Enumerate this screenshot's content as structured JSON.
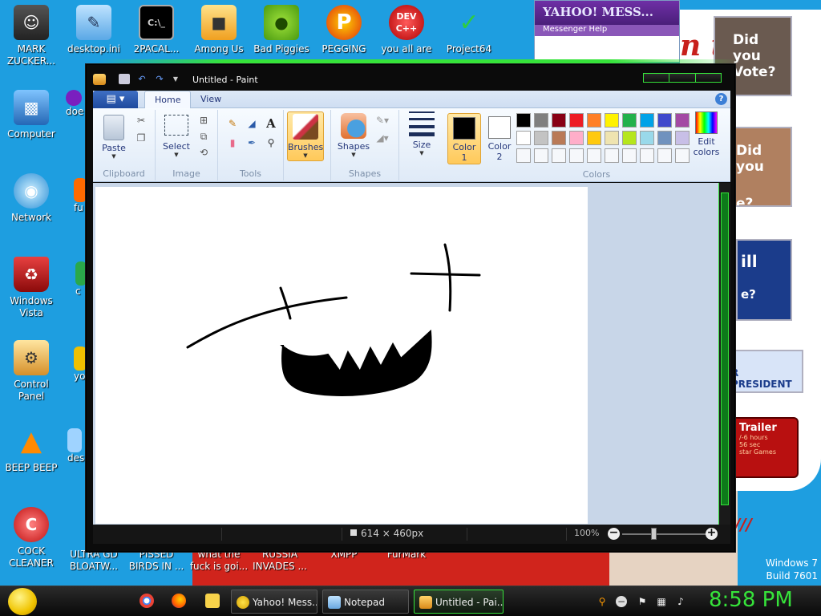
{
  "desktop": {
    "icons_left": [
      {
        "label": "MARK ZUCKER...",
        "icon": "user-folder-icon"
      },
      {
        "label": "Computer",
        "icon": "computer-icon"
      },
      {
        "label": "Network",
        "icon": "network-globe-icon"
      },
      {
        "label": "Windows Vista",
        "icon": "recycle-bin-icon"
      },
      {
        "label": "Control Panel",
        "icon": "control-panel-icon"
      },
      {
        "label": "BEEP BEEP",
        "icon": "vlc-cone-icon"
      },
      {
        "label": "COCK CLEANER",
        "icon": "ccleaner-icon"
      }
    ],
    "icons_top": [
      {
        "label": "desktop.ini",
        "icon": "ini-file-icon"
      },
      {
        "label": "2PACAL...",
        "icon": "cmd-icon"
      },
      {
        "label": "Among Us",
        "icon": "among-us-icon"
      },
      {
        "label": "Bad Piggies",
        "icon": "bad-piggies-icon"
      },
      {
        "label": "PEGGING",
        "icon": "pegging-icon"
      },
      {
        "label": "you all are",
        "icon": "devcpp-icon"
      },
      {
        "label": "Project64",
        "icon": "project64-icon"
      }
    ],
    "partial_col2": [
      "doe",
      "fu",
      "c",
      "yo",
      "des"
    ],
    "icons_bottom": [
      {
        "label": "ULTRA GD BLOATW..."
      },
      {
        "label": "PISSED BIRDS IN ..."
      },
      {
        "label": "what the fuck is goi..."
      },
      {
        "label": "RUSSIA INVADES ..."
      },
      {
        "label": "XMPP"
      },
      {
        "label": "FurMark"
      }
    ],
    "yahoo_title": "YAHOO! MESS...",
    "yahoo_menu": "Messenger     Help",
    "ads": {
      "obama": "Did you",
      "obama_sub": "Vote?",
      "face2": "Did you",
      "face2_sub": "e?",
      "will": "ill",
      "will_sub": "e?",
      "president": "R PRESIDENT",
      "trailer": "Trailer",
      "trailer_small": "/-6 hours\n56 sec\nstar Games"
    },
    "red_text": "n t",
    "windows_version": "Windows 7",
    "build": "Build 7601"
  },
  "paint": {
    "title": "Untitled - Paint",
    "tabs": [
      "Home",
      "View"
    ],
    "groups": {
      "clipboard": "Clipboard",
      "image": "Image",
      "tools": "Tools",
      "shapes": "Shapes",
      "colors": "Colors"
    },
    "buttons": {
      "paste": "Paste",
      "select": "Select",
      "brushes": "Brushes",
      "shapes": "Shapes",
      "size": "Size",
      "color1": "Color 1",
      "color2": "Color 2",
      "edit_colors": "Edit colors"
    },
    "palette_row1": [
      "#000000",
      "#7f7f7f",
      "#880015",
      "#ed1c24",
      "#ff7f27",
      "#fff200",
      "#22b14c",
      "#00a2e8",
      "#3f48cc",
      "#a349a4"
    ],
    "palette_row2": [
      "#ffffff",
      "#c3c3c3",
      "#b97a57",
      "#ffaec9",
      "#ffc90e",
      "#efe4b0",
      "#b5e61d",
      "#99d9ea",
      "#7092be",
      "#c8bfe7"
    ],
    "color1_value": "#000000",
    "color2_value": "#ffffff",
    "status": {
      "dimensions": "614 × 460px",
      "zoom": "100%"
    }
  },
  "taskbar": {
    "tasks": [
      "Yahoo! Mess...",
      "Notepad",
      "Untitled - Pai..."
    ],
    "clock": "8:58 PM"
  }
}
